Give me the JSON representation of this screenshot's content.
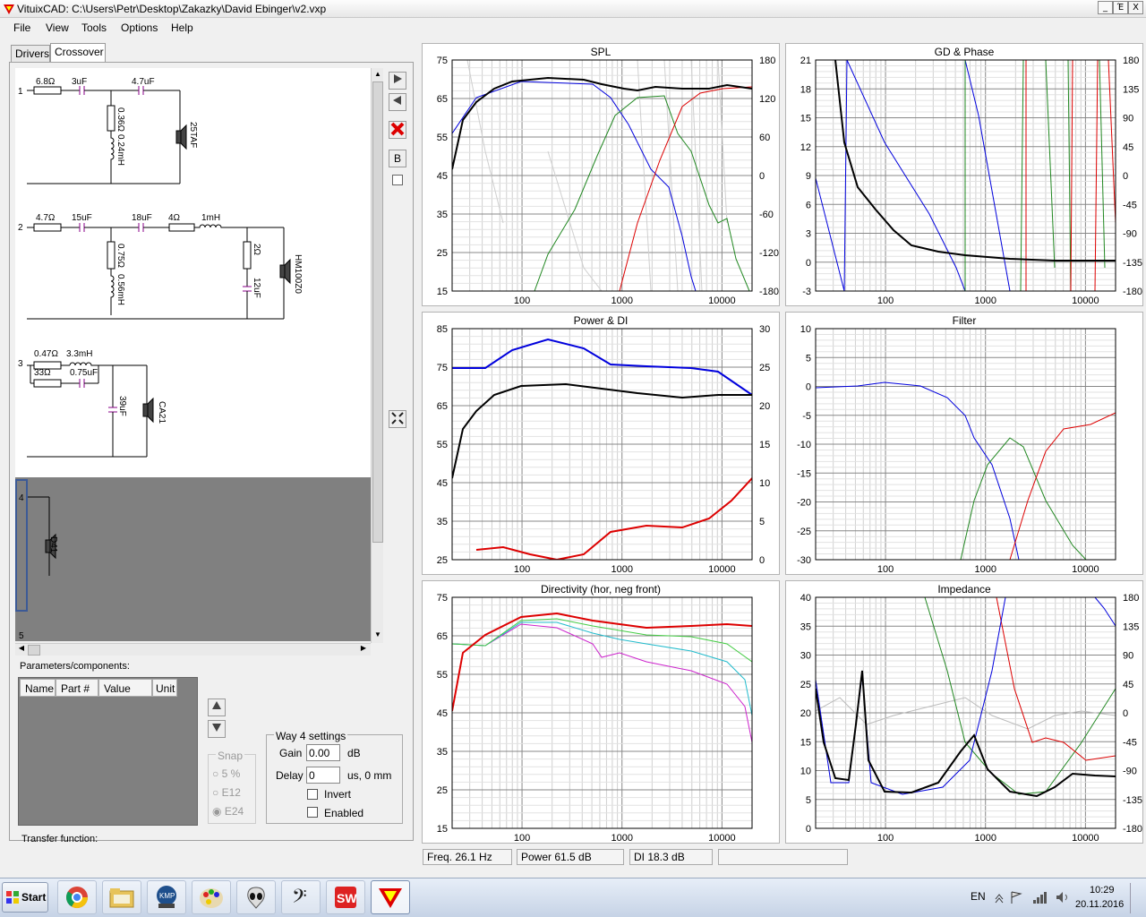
{
  "window": {
    "title": "VituixCAD: C:\\Users\\Petr\\Desktop\\Zakazky\\David Ebinger\\v2.vxp",
    "min": "_",
    "max": "Έ",
    "close": "X"
  },
  "menu": [
    "File",
    "View",
    "Tools",
    "Options",
    "Help"
  ],
  "tabs": [
    "Drivers",
    "Crossover"
  ],
  "schematic": {
    "way1": {
      "num": "1",
      "r1": "6.8Ω",
      "c1": "3uF",
      "c2": "4.7uF",
      "r2": "0.36Ω",
      "l1": "0.24mH",
      "driver": "25TAF"
    },
    "way2": {
      "num": "2",
      "r1": "4.7Ω",
      "c1": "15uF",
      "c2": "18uF",
      "r2": "4Ω",
      "l1": "1mH",
      "r3": "0.75Ω",
      "l2": "0.56mH",
      "r4": "2Ω",
      "c3": "12uF",
      "driver": "HM100Z0"
    },
    "way3": {
      "num": "3",
      "r1": "0.47Ω",
      "l1": "3.3mH",
      "r2": "33Ω",
      "c1": "0.75uF",
      "c2": "39uF",
      "driver": "CA21"
    },
    "way4": {
      "num": "4",
      "driver": "D41"
    },
    "way5": {
      "num": "5"
    }
  },
  "toolbar": {
    "b_label": "B"
  },
  "params": {
    "title": "Parameters/components:",
    "cols": [
      "Name",
      "Part #",
      "Value",
      "Unit"
    ]
  },
  "snap": {
    "title": "Snap",
    "opts": [
      "5 %",
      "E12",
      "E24"
    ]
  },
  "way_settings": {
    "title": "Way 4 settings",
    "gain_label": "Gain",
    "gain_value": "0.00",
    "gain_unit": "dB",
    "delay_label": "Delay",
    "delay_value": "0",
    "delay_unit": "us, 0 mm",
    "invert": "Invert",
    "enabled": "Enabled"
  },
  "transfer": "Transfer function:",
  "panels": {
    "spl": {
      "title": "SPL",
      "yl": [
        "75",
        "65",
        "55",
        "45",
        "35",
        "25",
        "15"
      ],
      "yr": [
        "180",
        "120",
        "60",
        "0",
        "-60",
        "-120",
        "-180"
      ],
      "x": [
        "100",
        "1000",
        "10000"
      ]
    },
    "gd": {
      "title": "GD & Phase",
      "yl": [
        "21",
        "18",
        "15",
        "12",
        "9",
        "6",
        "3",
        "0",
        "-3"
      ],
      "yr": [
        "180",
        "135",
        "90",
        "45",
        "0",
        "-45",
        "-90",
        "-135",
        "-180"
      ],
      "x": [
        "100",
        "1000",
        "10000"
      ]
    },
    "power": {
      "title": "Power & DI",
      "yl": [
        "85",
        "75",
        "65",
        "55",
        "45",
        "35",
        "25"
      ],
      "yr": [
        "30",
        "25",
        "20",
        "15",
        "10",
        "5",
        "0"
      ],
      "x": [
        "100",
        "1000",
        "10000"
      ]
    },
    "filter": {
      "title": "Filter",
      "yl": [
        "10",
        "5",
        "0",
        "-5",
        "-10",
        "-15",
        "-20",
        "-25",
        "-30"
      ],
      "yr": [],
      "x": [
        "100",
        "1000",
        "10000"
      ]
    },
    "dir": {
      "title": "Directivity (hor, neg front)",
      "yl": [
        "75",
        "65",
        "55",
        "45",
        "35",
        "25",
        "15"
      ],
      "yr": [],
      "x": [
        "100",
        "1000",
        "10000"
      ]
    },
    "imp": {
      "title": "Impedance",
      "yl": [
        "40",
        "35",
        "30",
        "25",
        "20",
        "15",
        "10",
        "5",
        "0"
      ],
      "yr": [
        "180",
        "135",
        "90",
        "45",
        "0",
        "-45",
        "-90",
        "-135",
        "-180"
      ],
      "x": [
        "100",
        "1000",
        "10000"
      ]
    }
  },
  "status": {
    "freq": "Freq.  26.1 Hz",
    "power": "Power  61.5 dB",
    "di": "DI  18.3 dB"
  },
  "taskbar": {
    "start": "Start",
    "lang": "EN",
    "time": "10:29",
    "date": "20.11.2016"
  },
  "colors": {
    "accent": "#cc0000",
    "black_curve": "#000000",
    "blue_curve": "#0000dd",
    "red_curve": "#dd0000",
    "green_curve": "#228822"
  }
}
